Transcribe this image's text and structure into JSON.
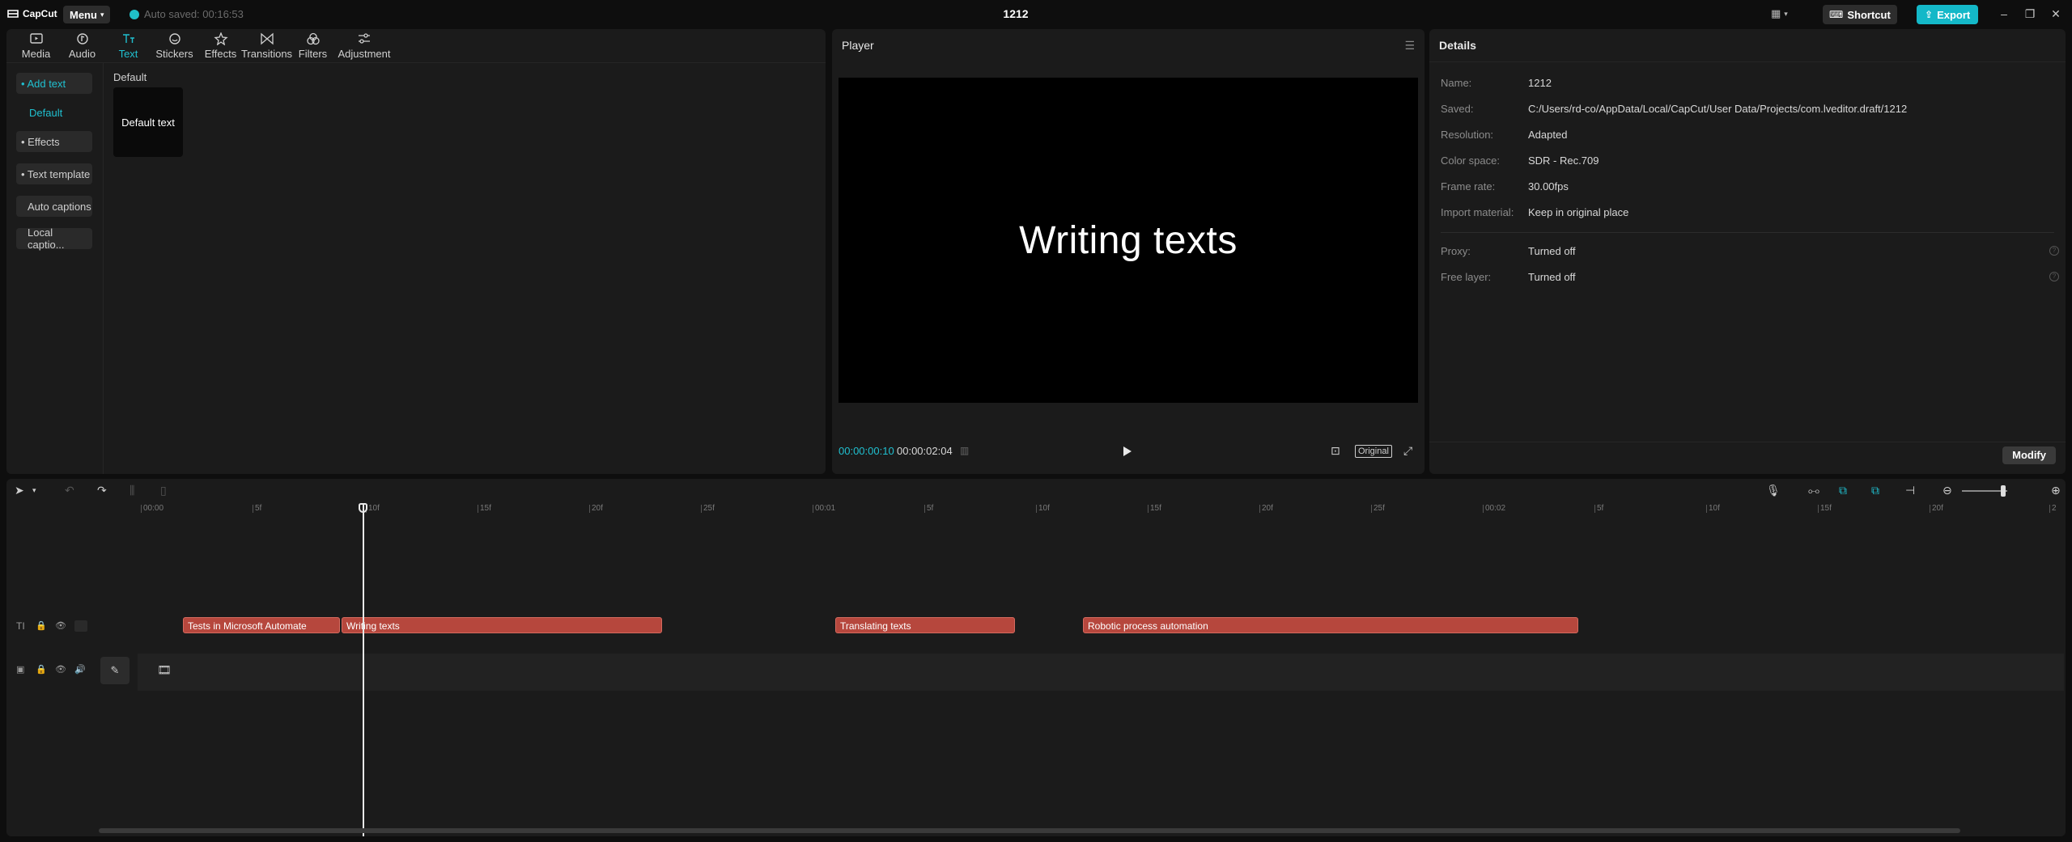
{
  "titlebar": {
    "logo": "CapCut",
    "menu_label": "Menu",
    "autosave": "Auto saved: 00:16:53",
    "project_title": "1212",
    "shortcut_label": "Shortcut",
    "export_label": "Export"
  },
  "media": {
    "tabs": [
      {
        "label": "Media",
        "icon": "media-icon"
      },
      {
        "label": "Audio",
        "icon": "audio-icon"
      },
      {
        "label": "Text",
        "icon": "text-icon"
      },
      {
        "label": "Stickers",
        "icon": "stickers-icon"
      },
      {
        "label": "Effects",
        "icon": "effects-icon"
      },
      {
        "label": "Transitions",
        "icon": "transitions-icon"
      },
      {
        "label": "Filters",
        "icon": "filters-icon"
      },
      {
        "label": "Adjustment",
        "icon": "adjustment-icon"
      }
    ],
    "active_tab": "Text",
    "sidebar": {
      "add_text": "• Add text",
      "default": "Default",
      "effects": "• Effects",
      "text_template": "• Text template",
      "auto_captions": "Auto captions",
      "local_captions": "Local captio..."
    },
    "section_label": "Default",
    "card_label": "Default text"
  },
  "player": {
    "title": "Player",
    "preview_text": "Writing texts",
    "current_time": "00:00:00:10",
    "total_time": "00:00:02:04",
    "original_label": "Original"
  },
  "details": {
    "title": "Details",
    "rows": [
      {
        "key": "Name:",
        "value": "1212"
      },
      {
        "key": "Saved:",
        "value": "C:/Users/rd-co/AppData/Local/CapCut/User Data/Projects/com.lveditor.draft/1212"
      },
      {
        "key": "Resolution:",
        "value": "Adapted"
      },
      {
        "key": "Color space:",
        "value": "SDR - Rec.709"
      },
      {
        "key": "Frame rate:",
        "value": "30.00fps"
      },
      {
        "key": "Import material:",
        "value": "Keep in original place"
      }
    ],
    "rows2": [
      {
        "key": "Proxy:",
        "value": "Turned off"
      },
      {
        "key": "Free layer:",
        "value": "Turned off"
      }
    ],
    "modify_label": "Modify"
  },
  "timeline": {
    "ruler": [
      "00:00",
      "5f",
      "10f",
      "15f",
      "20f",
      "25f",
      "00:01",
      "5f",
      "10f",
      "15f",
      "20f",
      "25f",
      "00:02",
      "5f",
      "10f",
      "15f",
      "20f",
      "2"
    ],
    "clips": [
      {
        "label": "Tests in Microsoft Automate"
      },
      {
        "label": "Writing texts"
      },
      {
        "label": "Translating texts"
      },
      {
        "label": "Robotic process automation"
      }
    ]
  }
}
